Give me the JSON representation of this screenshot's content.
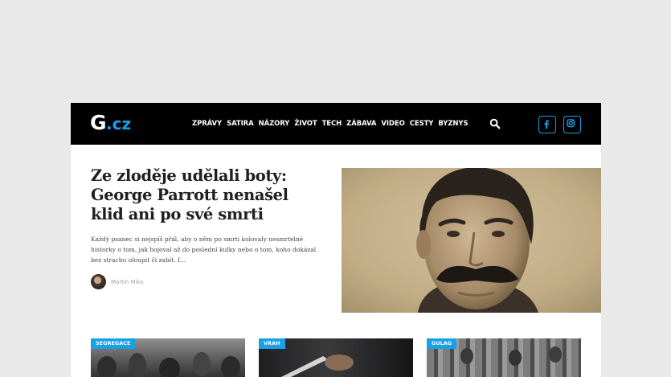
{
  "header": {
    "logo_g": "G",
    "logo_domain": ".cz",
    "nav": [
      "ZPRÁVY",
      "SATIRA",
      "NÁZORY",
      "ŽIVOT",
      "TECH",
      "ZÁBAVA",
      "VIDEO",
      "CESTY",
      "BYZNYS"
    ],
    "icons": {
      "search": "search-icon",
      "facebook": "facebook-icon",
      "instagram": "instagram-icon"
    },
    "accent_color": "#1aa0e6",
    "background_color": "#000000"
  },
  "hero": {
    "title": "Ze zloděje udělali boty: George Parrott nenašel klid ani po své smrti",
    "excerpt": "Každý psanec si nejspíš přál, aby o něm po smrti kolovaly nesmrtelné historky o tom, jak bojoval až do poslední kulky nebo o tom, koho dokázal bez strachu oloupit či zabít. I...",
    "author": "Martin Miko"
  },
  "cards": [
    {
      "tag": "SEGREGACE"
    },
    {
      "tag": "VRAH"
    },
    {
      "tag": "GULAG"
    }
  ]
}
